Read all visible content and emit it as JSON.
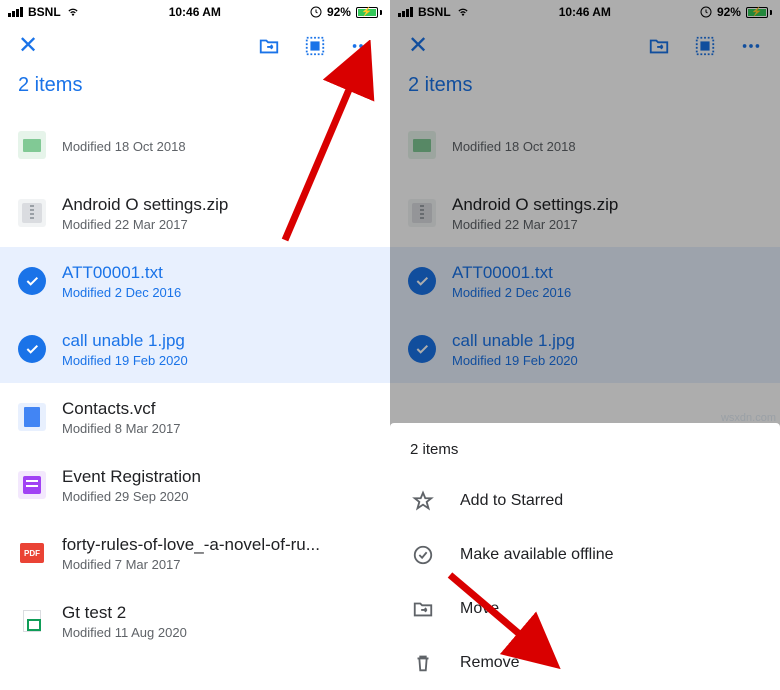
{
  "status": {
    "carrier": "BSNL",
    "time": "10:46 AM",
    "battery": "92%"
  },
  "selection_label": "2 items",
  "files": [
    {
      "name": "",
      "modified": "Modified 18 Oct 2018",
      "icon": "folder",
      "selected": false
    },
    {
      "name": "Android O settings.zip",
      "modified": "Modified 22 Mar 2017",
      "icon": "zip",
      "selected": false
    },
    {
      "name": "ATT00001.txt",
      "modified": "Modified 2 Dec 2016",
      "icon": "",
      "selected": true
    },
    {
      "name": "call unable 1.jpg",
      "modified": "Modified 19 Feb 2020",
      "icon": "",
      "selected": true
    },
    {
      "name": "Contacts.vcf",
      "modified": "Modified 8 Mar 2017",
      "icon": "docblue",
      "selected": false
    },
    {
      "name": "Event Registration",
      "modified": "Modified 29 Sep 2020",
      "icon": "form",
      "selected": false
    },
    {
      "name": "forty-rules-of-love_-a-novel-of-ru...",
      "modified": "Modified 7 Mar 2017",
      "icon": "pdf",
      "selected": false
    },
    {
      "name": "Gt test 2",
      "modified": "Modified 11 Aug 2020",
      "icon": "sheet",
      "selected": false
    }
  ],
  "sheet": {
    "title": "2 items",
    "items": [
      {
        "label": "Add to Starred",
        "icon": "star"
      },
      {
        "label": "Make available offline",
        "icon": "offline"
      },
      {
        "label": "Move",
        "icon": "move"
      },
      {
        "label": "Remove",
        "icon": "trash"
      }
    ]
  },
  "watermark": "wsxdn.com"
}
